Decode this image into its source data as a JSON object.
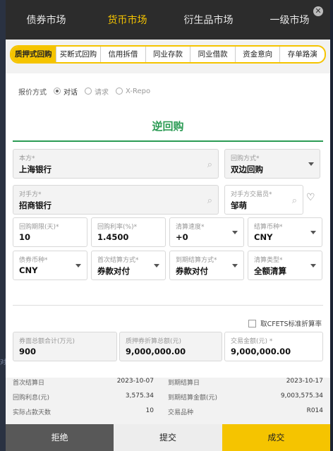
{
  "nav": {
    "tabs": [
      "债券市场",
      "货币市场",
      "衍生品市场",
      "一级市场"
    ],
    "active": 1,
    "close_icon": "close-icon"
  },
  "subtabs": [
    "质押式回购",
    "买断式回购",
    "信用拆借",
    "同业存款",
    "同业借款",
    "资金意向",
    "存单路演"
  ],
  "quote": {
    "label": "报价方式",
    "options": [
      "对话",
      "请求",
      "X-Repo"
    ],
    "selected": "对话"
  },
  "form": {
    "title": "逆回购",
    "own": {
      "label": "本方*",
      "value": "上海银行"
    },
    "repo_method": {
      "label": "回购方式*",
      "value": "双边回购"
    },
    "counterparty": {
      "label": "对手方*",
      "value": "招商银行"
    },
    "trader": {
      "label": "对手方交易员*",
      "value": "邹萌"
    },
    "term": {
      "label": "回购期限(天)*",
      "value": "10"
    },
    "rate": {
      "label": "回购利率(%)*",
      "value": "1.4500"
    },
    "speed": {
      "label": "清算速度*",
      "value": "+0"
    },
    "currency": {
      "label": "结算币种*",
      "value": "CNY"
    },
    "bond_currency": {
      "label": "债券币种*",
      "value": "CNY"
    },
    "first_settle": {
      "label": "首次结算方式*",
      "value": "券款对付"
    },
    "maturity_settle": {
      "label": "到期结算方式*",
      "value": "券款对付"
    },
    "clearing_type": {
      "label": "清算类型*",
      "value": "全额清算"
    },
    "cfets_label": "取CFETS标准折算率",
    "face_total": {
      "label": "券面总额合计(万元)",
      "value": "900"
    },
    "pledge_total": {
      "label": "质押券折算总额(元)",
      "value": "9,000,000.00"
    },
    "trade_amount": {
      "label": "交易金额(元) *",
      "value": "9,000,000.00"
    }
  },
  "summary": {
    "first_date_label": "首次结算日",
    "first_date": "2023-10-07",
    "maturity_date_label": "到期结算日",
    "maturity_date": "2023-10-17",
    "interest_label": "回购利息(元)",
    "interest": "3,575.34",
    "maturity_amount_label": "到期结算金额(元)",
    "maturity_amount": "9,003,575.34",
    "days_label": "实际占款天数",
    "days": "10",
    "variety_label": "交易品种",
    "variety": "R014"
  },
  "buttons": {
    "reject": "拒绝",
    "submit": "提交",
    "deal": "成交"
  },
  "colors": {
    "accent": "#f5c400",
    "heading": "#2b9b54",
    "nav_bg": "#2c2c2c"
  }
}
